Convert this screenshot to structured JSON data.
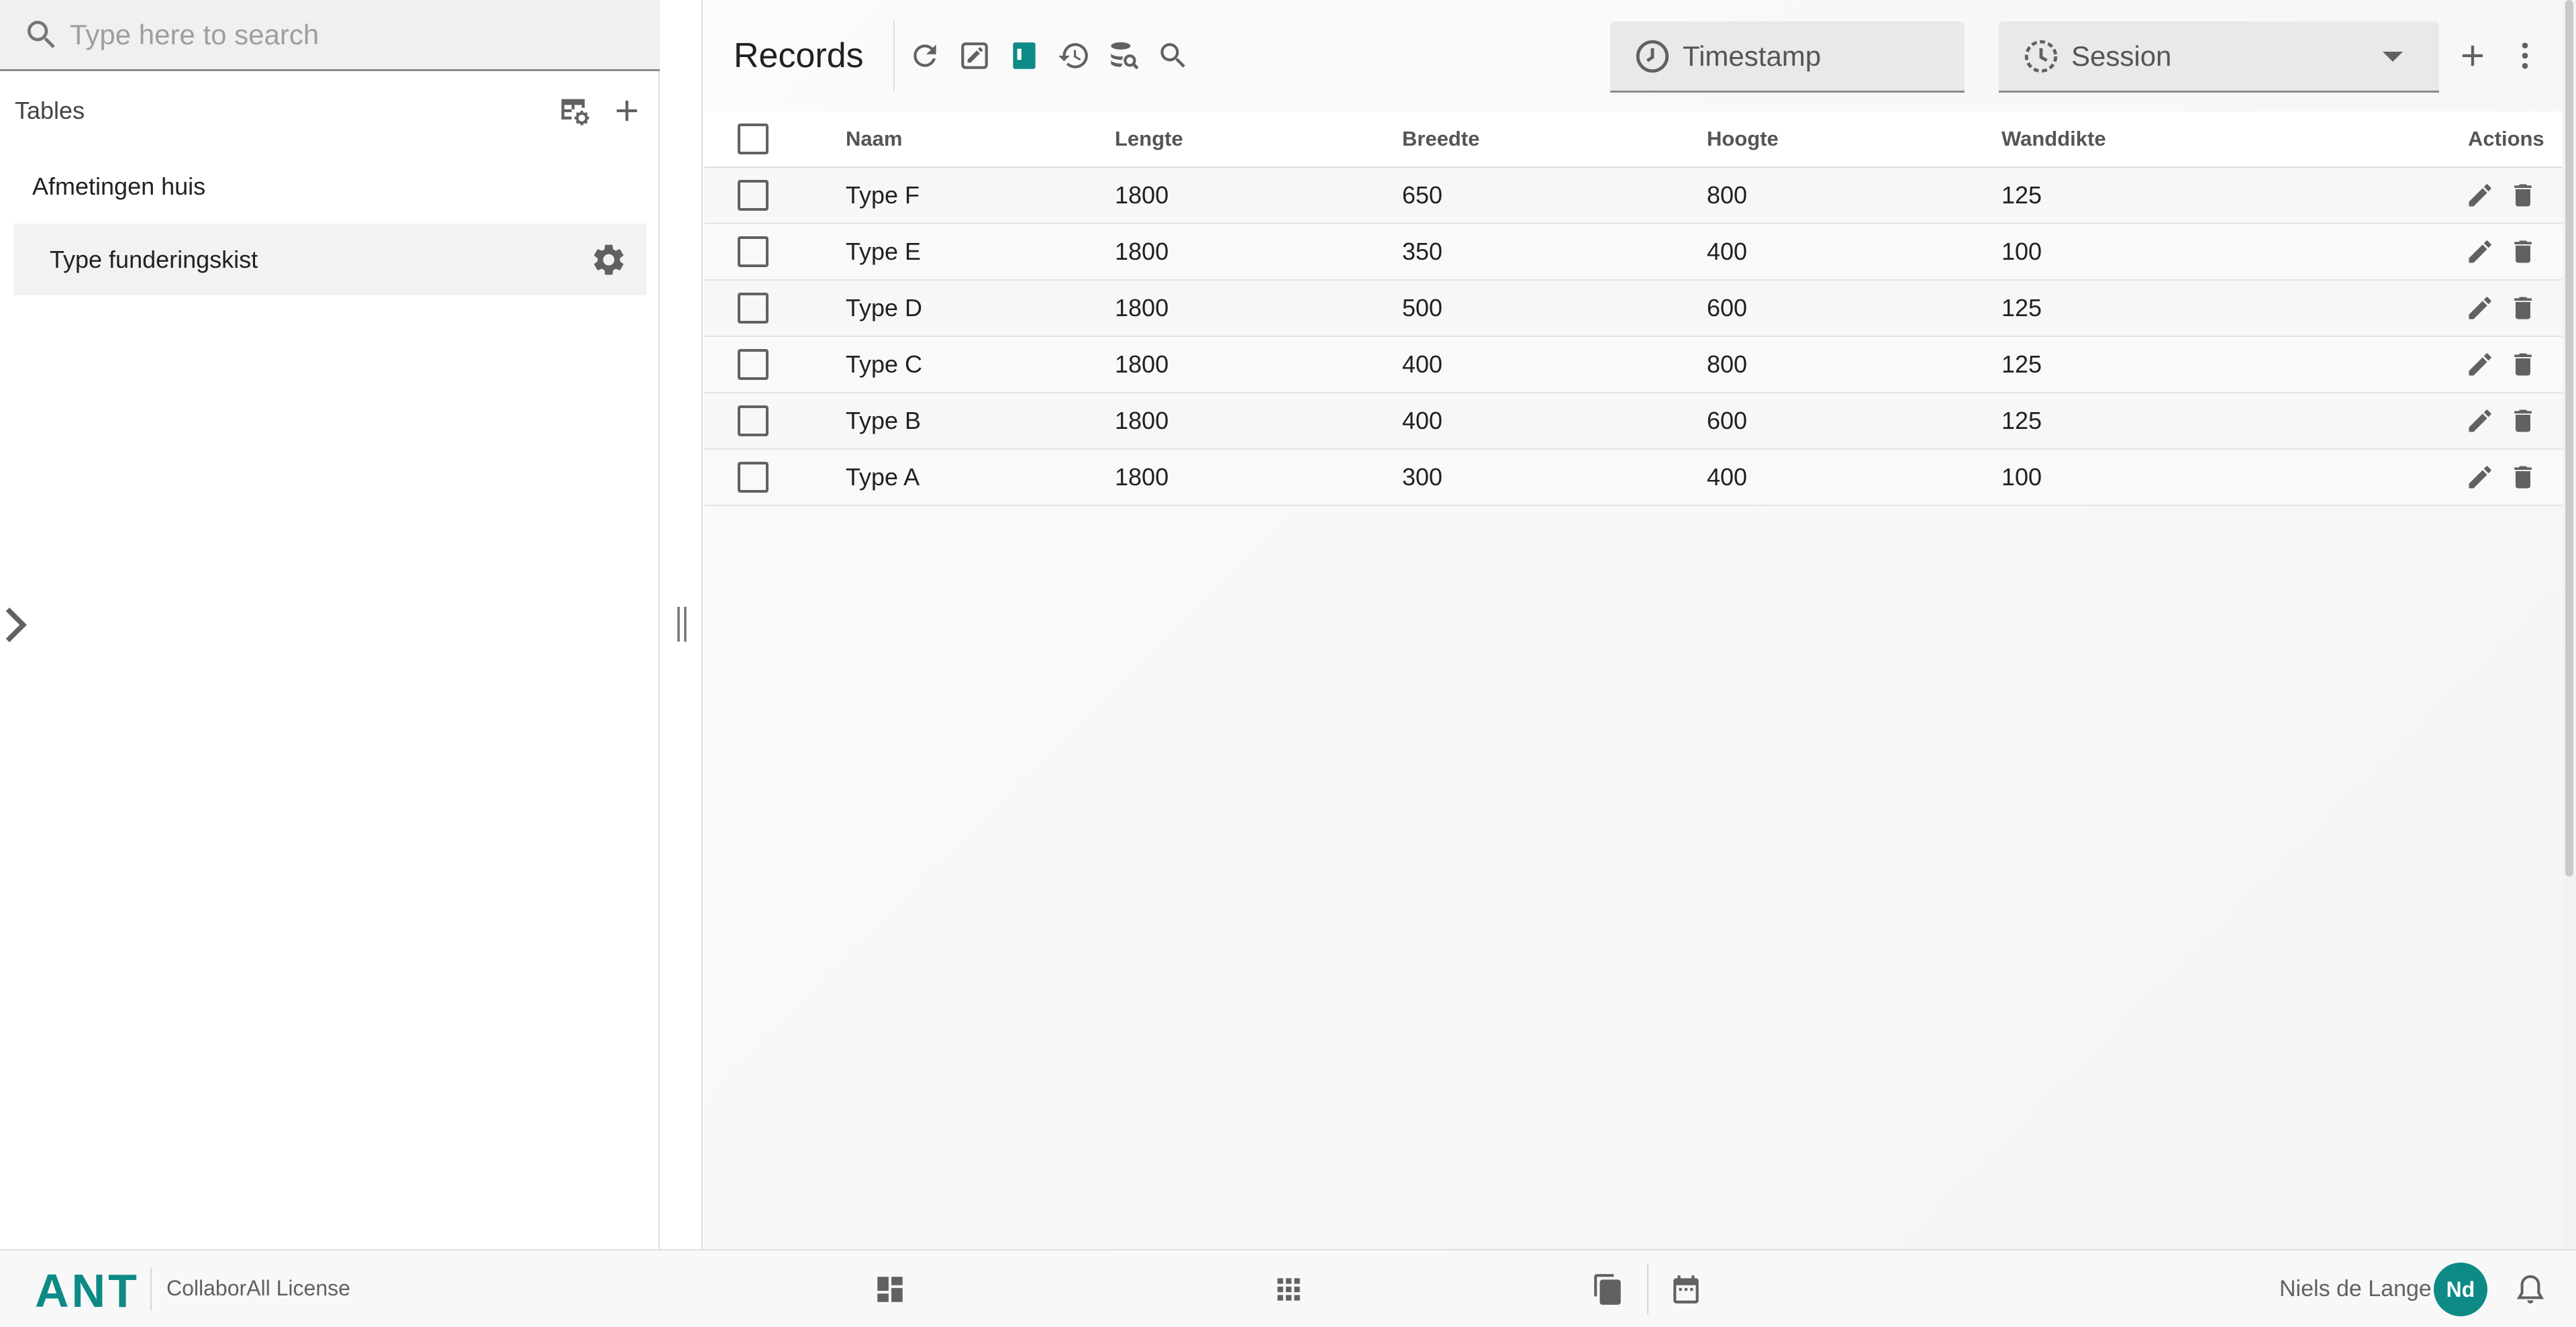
{
  "sidebar": {
    "search_placeholder": "Type here to search",
    "tables_title": "Tables",
    "items": [
      {
        "label": "Afmetingen huis"
      },
      {
        "label": "Type funderingskist"
      }
    ]
  },
  "main": {
    "title": "Records",
    "timestamp_placeholder": "Timestamp",
    "session_placeholder": "Session",
    "columns": [
      "Naam",
      "Lengte",
      "Breedte",
      "Hoogte",
      "Wanddikte",
      "Actions"
    ],
    "rows": [
      {
        "naam": "Type F",
        "lengte": "1800",
        "breedte": "650",
        "hoogte": "800",
        "wanddikte": "125"
      },
      {
        "naam": "Type E",
        "lengte": "1800",
        "breedte": "350",
        "hoogte": "400",
        "wanddikte": "100"
      },
      {
        "naam": "Type D",
        "lengte": "1800",
        "breedte": "500",
        "hoogte": "600",
        "wanddikte": "125"
      },
      {
        "naam": "Type C",
        "lengte": "1800",
        "breedte": "400",
        "hoogte": "800",
        "wanddikte": "125"
      },
      {
        "naam": "Type B",
        "lengte": "1800",
        "breedte": "400",
        "hoogte": "600",
        "wanddikte": "125"
      },
      {
        "naam": "Type A",
        "lengte": "1800",
        "breedte": "300",
        "hoogte": "400",
        "wanddikte": "100"
      }
    ]
  },
  "footer": {
    "brand": "ANT",
    "license": "CollaborAll License",
    "user_name": "Niels de Lange",
    "avatar_initials": "Nd"
  },
  "icons": {
    "search": "search-icon",
    "table_settings": "table-settings-icon",
    "add": "plus-icon",
    "gear": "gear-icon",
    "chevron": "chevron-right-icon",
    "refresh": "refresh-icon",
    "edit_mode": "edit-square-icon",
    "panel": "panel-icon",
    "history": "history-icon",
    "db_search": "database-search-icon",
    "clock": "clock-icon",
    "session_clock": "session-clock-icon",
    "more": "more-vert-icon",
    "edit": "pencil-icon",
    "delete": "trash-icon",
    "dashboard": "dashboard-icon",
    "apps": "apps-grid-icon",
    "clipboard": "clipboard-icon",
    "calendar": "calendar-icon",
    "bell": "bell-icon"
  },
  "colors": {
    "accent": "#0d8a86",
    "icon": "#616161"
  }
}
